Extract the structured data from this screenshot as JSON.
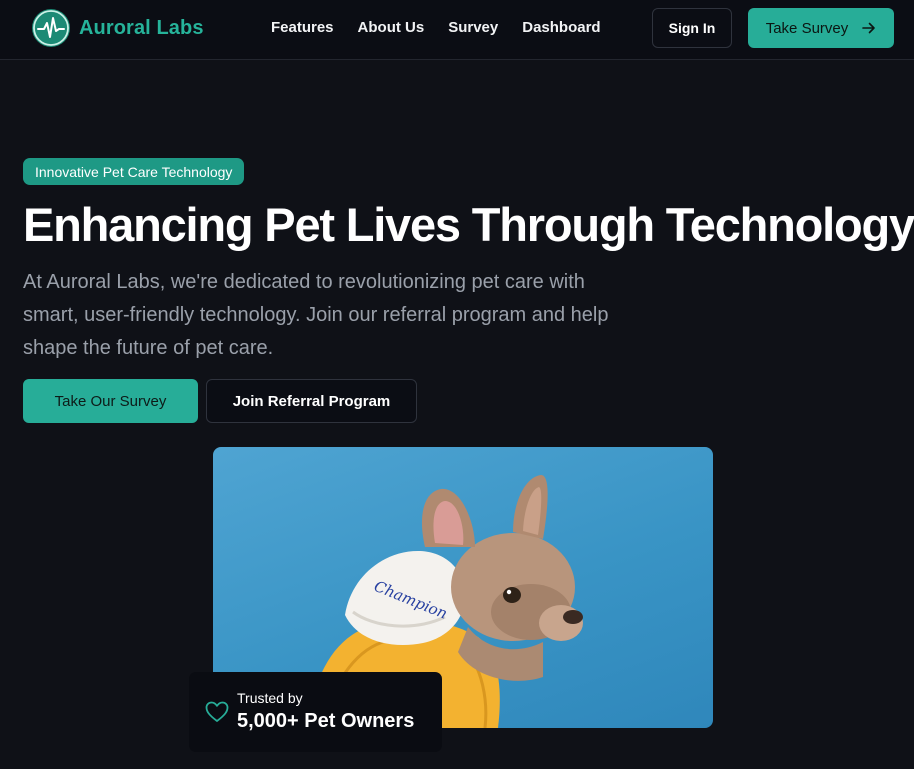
{
  "header": {
    "brand": "Auroral Labs",
    "nav": [
      "Features",
      "About Us",
      "Survey",
      "Dashboard"
    ],
    "sign_in": "Sign In",
    "take_survey": "Take Survey"
  },
  "hero": {
    "badge": "Innovative Pet Care Technology",
    "title": "Enhancing Pet Lives Through Technology",
    "description": "At Auroral Labs, we're dedicated to revolutionizing pet care with smart, user-friendly technology. Join our referral program and help shape the future of pet care.",
    "primary_button": "Take Our Survey",
    "secondary_button": "Join Referral Program",
    "hoodie_text": "Champion"
  },
  "trust_card": {
    "label": "Trusted by",
    "value": "5,000+ Pet Owners"
  },
  "colors": {
    "background": "#0f1117",
    "accent": "#27ad98",
    "brand_text": "#26b39a",
    "badge": "#1e9985",
    "muted_text": "#9aa0aa",
    "image_sky": "#3994c5",
    "hoodie": "#f3b230"
  },
  "icons": {
    "logo": "pulse-heartbeat-icon",
    "arrow": "arrow-right-icon",
    "trust": "heart-outline-icon"
  }
}
